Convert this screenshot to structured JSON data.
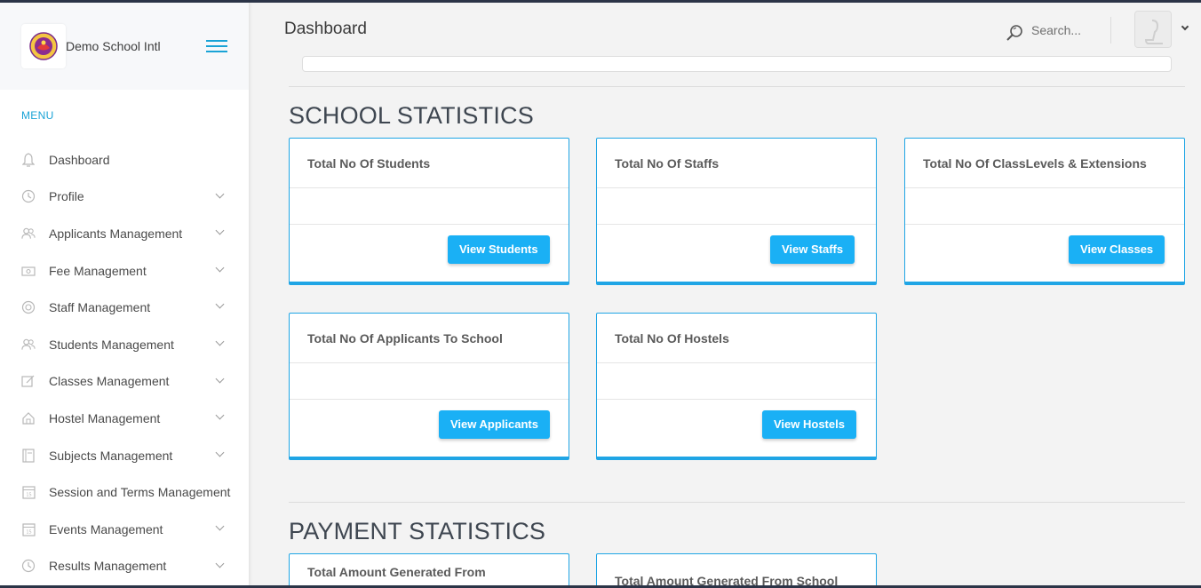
{
  "brand": {
    "name": "Demo School Intl"
  },
  "sidebar": {
    "menu_title": "MENU",
    "items": [
      {
        "label": "Dashboard",
        "icon": "bell-icon",
        "has_submenu": false
      },
      {
        "label": "Profile",
        "icon": "clock-icon",
        "has_submenu": true
      },
      {
        "label": "Applicants Management",
        "icon": "users-icon",
        "has_submenu": true
      },
      {
        "label": "Fee Management",
        "icon": "cash-icon",
        "has_submenu": true
      },
      {
        "label": "Staff Management",
        "icon": "support-icon",
        "has_submenu": true
      },
      {
        "label": "Students Management",
        "icon": "users-icon",
        "has_submenu": true
      },
      {
        "label": "Classes Management",
        "icon": "edit-icon",
        "has_submenu": true
      },
      {
        "label": "Hostel Management",
        "icon": "home-icon",
        "has_submenu": true
      },
      {
        "label": "Subjects Management",
        "icon": "notebook-icon",
        "has_submenu": true
      },
      {
        "label": "Session and Terms Management",
        "icon": "calendar-icon",
        "has_submenu": false
      },
      {
        "label": "Events Management",
        "icon": "calendar-icon",
        "has_submenu": true
      },
      {
        "label": "Results Management",
        "icon": "clock-icon",
        "has_submenu": true
      }
    ]
  },
  "header": {
    "title": "Dashboard",
    "search_placeholder": "Search..."
  },
  "school_stats": {
    "title": "SCHOOL STATISTICS",
    "cards": [
      {
        "title": "Total No Of Students",
        "value": "",
        "button": "View Students"
      },
      {
        "title": "Total No Of Staffs",
        "value": "",
        "button": "View Staffs"
      },
      {
        "title": "Total No Of ClassLevels & Extensions",
        "value": "",
        "button": "View Classes"
      },
      {
        "title": "Total No Of Applicants To School",
        "value": "",
        "button": "View Applicants"
      },
      {
        "title": "Total No Of Hostels",
        "value": "",
        "button": "View Hostels"
      }
    ]
  },
  "payment_stats": {
    "title": "PAYMENT STATISTICS",
    "cards": [
      {
        "title": "Total Amount Generated From Application Fees"
      },
      {
        "title": "Total Amount Generated From School Fees"
      }
    ]
  },
  "colors": {
    "accent": "#1fa5e5",
    "button": "#1ab0f5",
    "menu_title": "#1aa3d6"
  }
}
